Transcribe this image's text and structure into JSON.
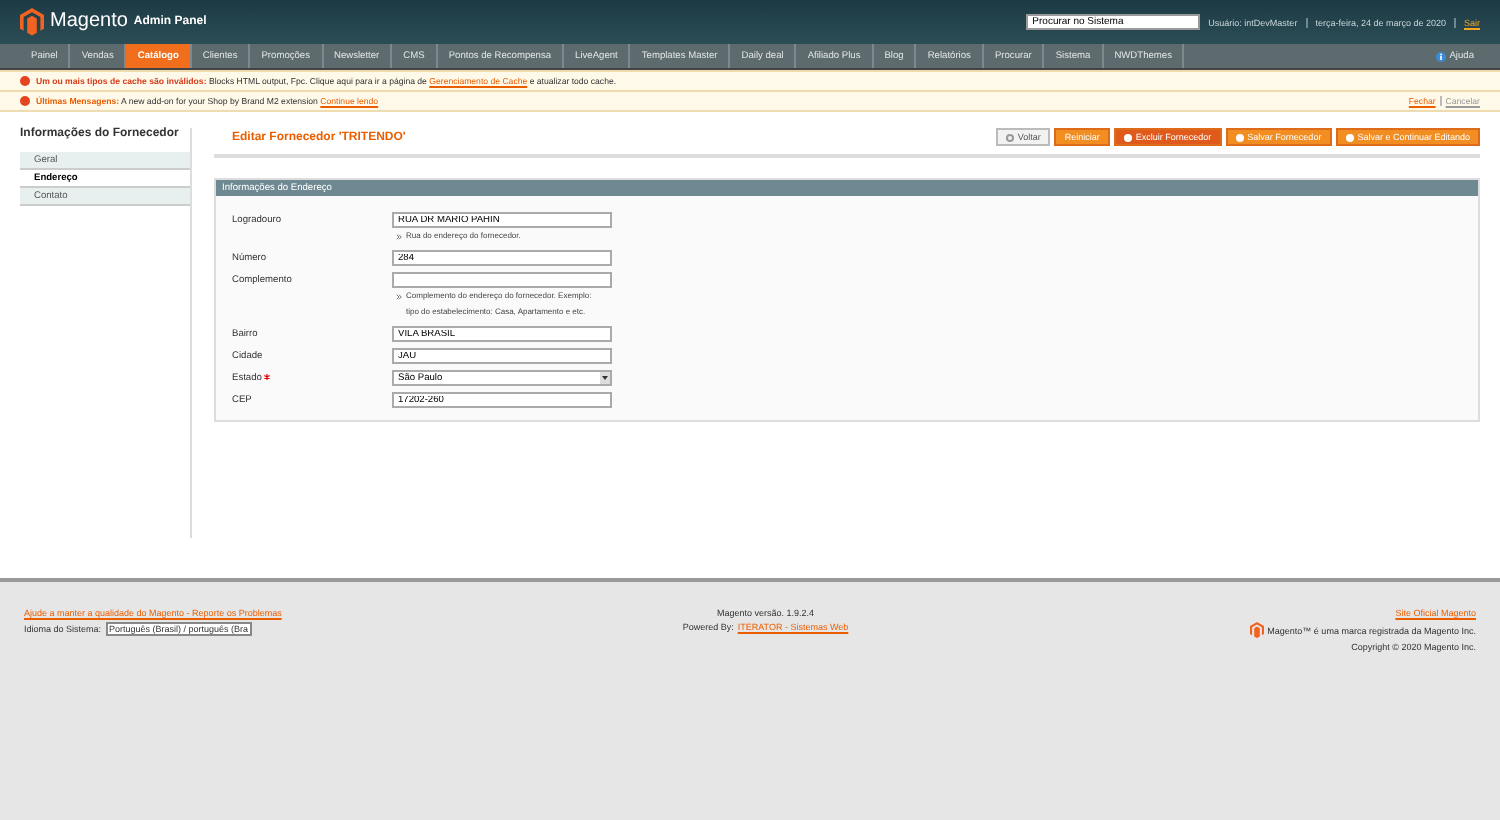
{
  "header": {
    "logo": "Magento",
    "logo_sub": "Admin Panel",
    "search": {
      "value": "Procurar no Sistema"
    },
    "user": "Usuário: intDevMaster",
    "date": "terça-feira, 24 de março de 2020",
    "logout": "Sair"
  },
  "nav": {
    "items": [
      {
        "label": "Painel",
        "selected": false
      },
      {
        "label": "Vendas",
        "selected": false
      },
      {
        "label": "Catálogo",
        "selected": true
      },
      {
        "label": "Clientes",
        "selected": false
      },
      {
        "label": "Promoções",
        "selected": false
      },
      {
        "label": "Newsletter",
        "selected": false
      },
      {
        "label": "CMS",
        "selected": false
      },
      {
        "label": "Pontos de Recompensa",
        "selected": false
      },
      {
        "label": "LiveAgent",
        "selected": false
      },
      {
        "label": "Templates Master",
        "selected": false
      },
      {
        "label": "Daily deal",
        "selected": false
      },
      {
        "label": "Afiliado Plus",
        "selected": false
      },
      {
        "label": "Blog",
        "selected": false
      },
      {
        "label": "Relatórios",
        "selected": false
      },
      {
        "label": "Procurar",
        "selected": false
      },
      {
        "label": "Sistema",
        "selected": false
      },
      {
        "label": "NWDThemes",
        "selected": false
      }
    ],
    "help": "Ajuda"
  },
  "messages": [
    {
      "title": "Um ou mais tipos de cache são inválidos:",
      "text": "Blocks HTML output, Fpc. Clique aqui para ir a página de",
      "link": "Gerenciamento de Cache",
      "after": "e atualizar todo cache."
    },
    {
      "title": "Últimas Mensagens:",
      "text": "A new add-on for your Shop by Brand M2 extension",
      "link": "Continue lendo"
    }
  ],
  "message_actions": [
    "Fechar",
    "Cancelar"
  ],
  "sidebar": {
    "title": "Informações do Fornecedor",
    "items": [
      {
        "label": "Geral",
        "selected": false
      },
      {
        "label": "Endereço",
        "selected": true
      },
      {
        "label": "Contato",
        "selected": false
      }
    ]
  },
  "page_title": "Editar Fornecedor 'TRITENDO'",
  "buttons": [
    {
      "label": "Voltar",
      "kind": "back"
    },
    {
      "label": "Reiniciar",
      "kind": "plain"
    },
    {
      "label": "Excluir Fornecedor",
      "kind": "delete"
    },
    {
      "label": "Salvar Fornecedor",
      "kind": "save"
    },
    {
      "label": "Salvar e Continuar Editando",
      "kind": "save"
    }
  ],
  "fieldset": {
    "title": "Informações do Endereço",
    "fields": [
      {
        "label": "Logradouro",
        "kind": "text",
        "value": "RUA DR MARIO PAHIN",
        "required": false,
        "note": [
          "Rua do endereço do fornecedor."
        ]
      },
      {
        "label": "Número",
        "kind": "text",
        "value": "284",
        "required": false
      },
      {
        "label": "Complemento",
        "kind": "text",
        "required": false,
        "note": [
          "Complemento do endereço do fornecedor. Exemplo:",
          "tipo do estabelecimento: Casa, Apartamento e etc."
        ]
      },
      {
        "label": "Bairro",
        "kind": "text",
        "value": "VILA BRASIL",
        "required": false
      },
      {
        "label": "Cidade",
        "kind": "text",
        "value": "JAU",
        "required": false
      },
      {
        "label": "Estado",
        "kind": "select",
        "value": "São Paulo",
        "required": true
      },
      {
        "label": "CEP",
        "kind": "text",
        "value": "17202-260",
        "required": false
      }
    ]
  },
  "footer": {
    "bug_link": "Ajude a manter a qualidade do Magento - Reporte os Problemas",
    "locale_label": "Idioma do Sistema:",
    "locale_value": "Português (Brasil) / português (Bra",
    "version": "Magento versão. 1.9.2.4",
    "powered_label": "Powered By:",
    "powered_link": "ITERATOR - Sistemas Web",
    "site_link": "Site Oficial Magento",
    "trademark": "Magento™ é uma marca registrada da Magento Inc.",
    "copyright": "Copyright © 2020 Magento Inc."
  }
}
